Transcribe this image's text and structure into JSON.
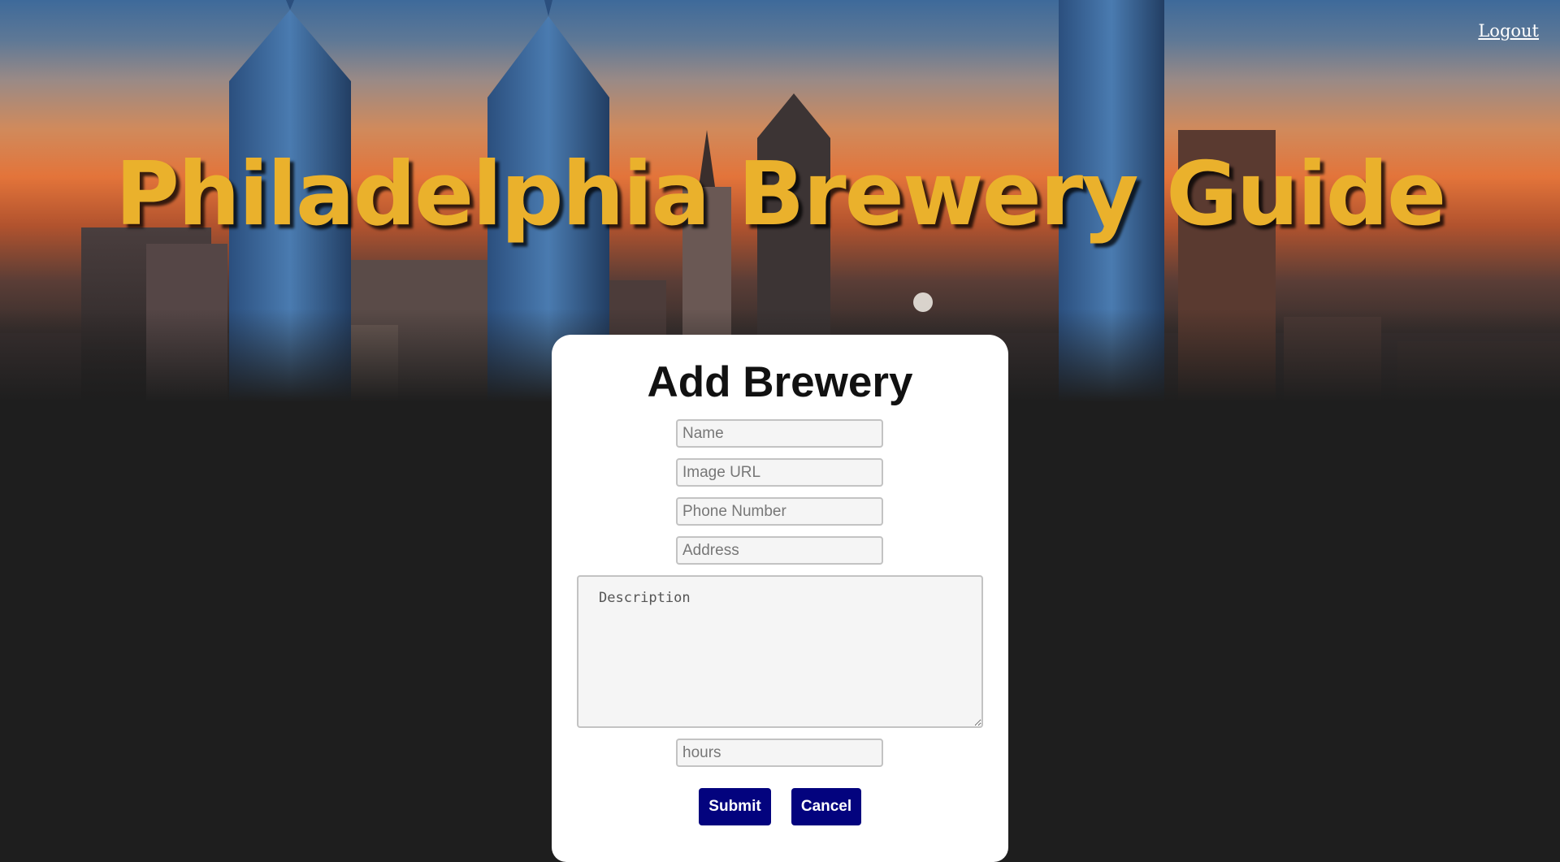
{
  "header": {
    "title": "Philadelphia Brewery Guide",
    "logout_label": "Logout",
    "title_color": "#eab12c"
  },
  "form": {
    "title": "Add Brewery",
    "fields": {
      "name": {
        "placeholder": "Name",
        "value": ""
      },
      "image_url": {
        "placeholder": "Image URL",
        "value": ""
      },
      "phone": {
        "placeholder": "Phone Number",
        "value": ""
      },
      "address": {
        "placeholder": "Address",
        "value": ""
      },
      "description": {
        "placeholder": "Description",
        "value": ""
      },
      "hours": {
        "placeholder": "hours",
        "value": ""
      }
    },
    "submit_label": "Submit",
    "cancel_label": "Cancel",
    "button_color": "#03037e"
  },
  "background": {
    "image": "philadelphia-skyline-sunset",
    "page_color": "#1e1e1e"
  }
}
